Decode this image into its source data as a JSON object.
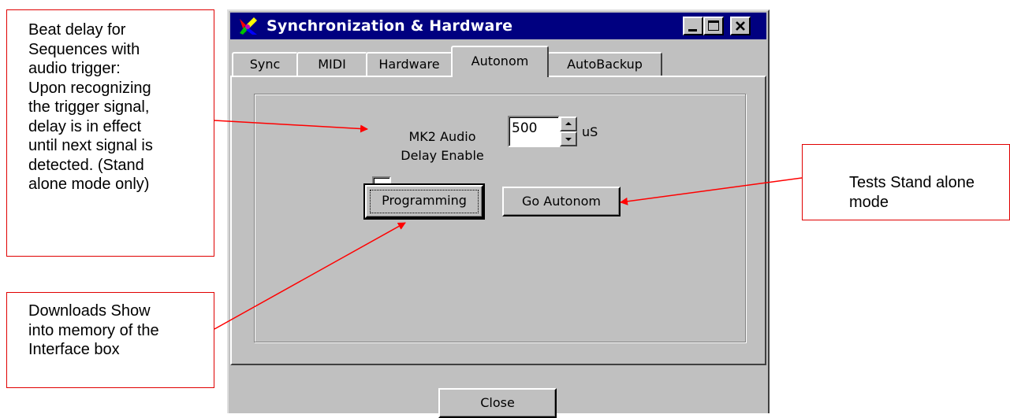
{
  "window": {
    "title": "Synchronization & Hardware"
  },
  "tabs": [
    {
      "label": "Sync",
      "selected": false
    },
    {
      "label": "MIDI",
      "selected": false
    },
    {
      "label": "Hardware",
      "selected": false
    },
    {
      "label": "Autonom",
      "selected": true
    },
    {
      "label": "AutoBackup",
      "selected": false
    }
  ],
  "autonom": {
    "checkbox_label_line1": "MK2 Audio",
    "checkbox_label_line2": "Delay Enable",
    "checkbox_checked": false,
    "delay_value": "500",
    "delay_unit": "uS",
    "programming_label": "Programming",
    "go_autonom_label": "Go Autonom"
  },
  "footer": {
    "close_label": "Close"
  },
  "callouts": {
    "beat_delay": [
      "Beat delay for",
      "Sequences with",
      "audio trigger:",
      "Upon recognizing",
      "the trigger signal,",
      "delay is in effect",
      "until next signal is",
      "detected. (Stand",
      "alone mode only)"
    ],
    "downloads": [
      "Downloads Show",
      "into memory of the",
      "Interface box"
    ],
    "tests": [
      "Tests Stand alone",
      "mode"
    ]
  },
  "colors": {
    "titlebar": "#000080",
    "face": "#c0c0c0",
    "callout_border": "#e00000",
    "arrow": "#ff0000"
  }
}
